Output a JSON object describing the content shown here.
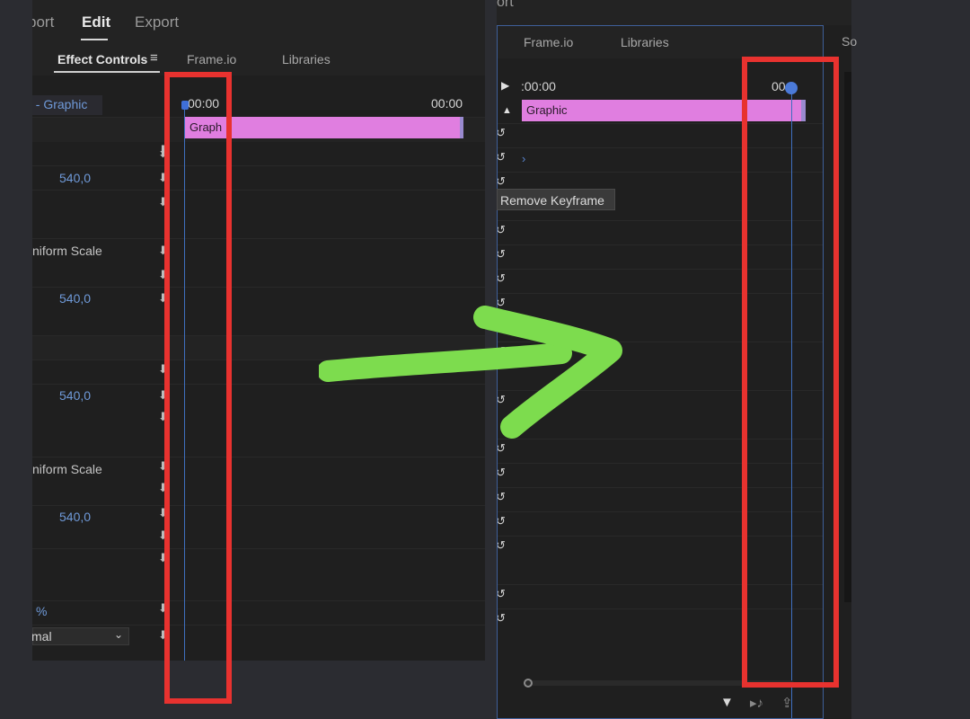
{
  "left": {
    "workspace_tabs": [
      "port",
      "Edit",
      "Export"
    ],
    "panel_tabs": [
      "Effect Controls",
      "Frame.io",
      "Libraries"
    ],
    "menu_icon": "hamburger-icon",
    "clip_header": ". - Graphic",
    "rows": [
      {
        "label": "",
        "value": "540,0"
      },
      {
        "label": "niform Scale",
        "value": ""
      },
      {
        "label": "",
        "value": "540,0"
      },
      {
        "label": "",
        "value": "540,0"
      },
      {
        "label": "niform Scale",
        "value": ""
      },
      {
        "label": "",
        "value": "540,0"
      },
      {
        "label": "",
        "value": "%"
      },
      {
        "label": "mal",
        "value": ""
      }
    ],
    "timecode_start": "00:00",
    "timecode_end": "00:00",
    "clip_name": "Graph",
    "keyframe_icon": "keyframe-toggle-icon"
  },
  "right": {
    "top_tab_fragment": "ort",
    "panel_tabs": [
      "Frame.io",
      "Libraries"
    ],
    "extra_tab": "So",
    "timecode_start": ":00:00",
    "timecode_end": "00:0",
    "clip_name": "Graphic",
    "tooltip": "Remove Keyframe",
    "bottom_icons": [
      "filter-icon",
      "play-audio-icon",
      "export-icon"
    ]
  },
  "annotations": {
    "arrow_color": "#7ddc4e",
    "box_color": "#e8322f"
  }
}
